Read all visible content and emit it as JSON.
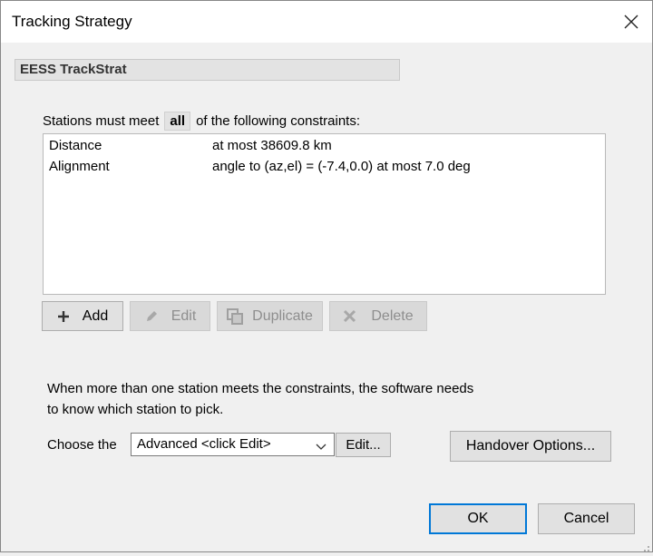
{
  "window": {
    "title": "Tracking Strategy"
  },
  "strategy_name": "EESS TrackStrat",
  "constraints_header": {
    "prefix": "Stations must meet",
    "mode": "all",
    "suffix": "of the following constraints:"
  },
  "constraints": [
    {
      "name": "Distance",
      "condition": "at most 38609.8 km"
    },
    {
      "name": "Alignment",
      "condition": "angle to (az,el) = (-7.4,0.0) at most 7.0 deg"
    }
  ],
  "list_buttons": {
    "add": "Add",
    "edit": "Edit",
    "duplicate": "Duplicate",
    "delete": "Delete"
  },
  "info": {
    "line1": "When more than one station meets the constraints, the software needs",
    "line2": "to know which station to pick."
  },
  "choose": {
    "label": "Choose the",
    "selected": "Advanced <click Edit>",
    "edit_button": "Edit..."
  },
  "handover_button": "Handover Options...",
  "dialog_buttons": {
    "ok": "OK",
    "cancel": "Cancel"
  },
  "colors": {
    "accent": "#0078d7",
    "disabled_text": "#8e8e8e"
  }
}
